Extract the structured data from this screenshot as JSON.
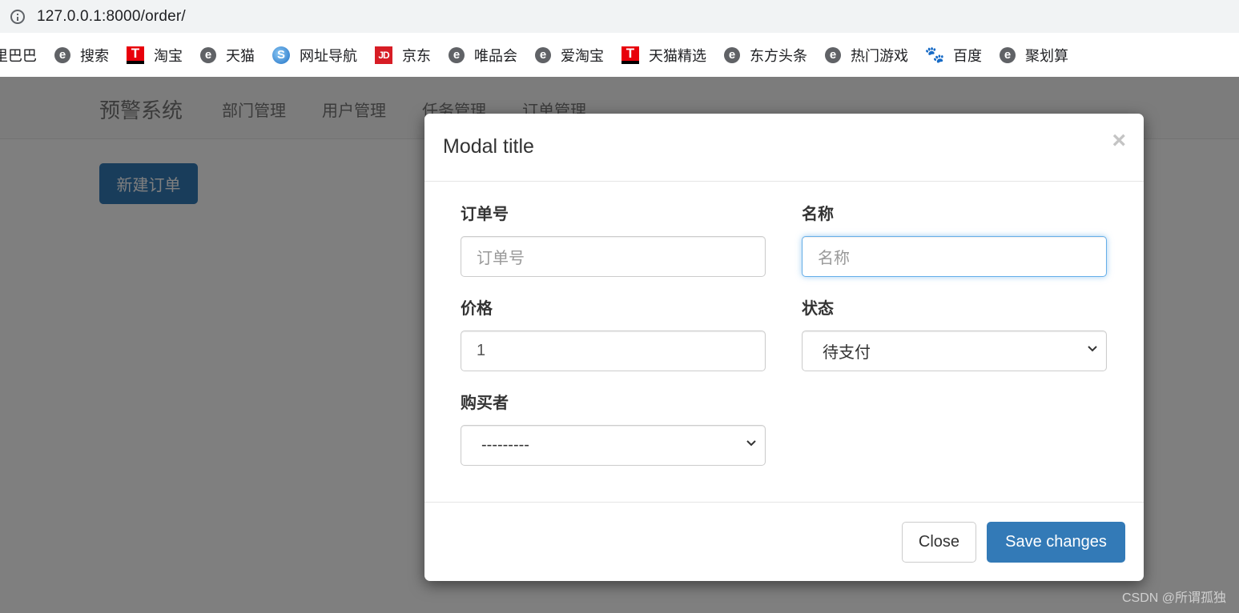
{
  "browser": {
    "url": "127.0.0.1:8000/order/",
    "bookmarks": [
      {
        "label": "里巴巴",
        "icon": "none"
      },
      {
        "label": "搜索",
        "icon": "ie-e-icon"
      },
      {
        "label": "淘宝",
        "icon": "tmall-t-icon"
      },
      {
        "label": "天猫",
        "icon": "ie-e-icon"
      },
      {
        "label": "网址导航",
        "icon": "sogou-s-icon"
      },
      {
        "label": "京东",
        "icon": "jd-icon"
      },
      {
        "label": "唯品会",
        "icon": "ie-e-icon"
      },
      {
        "label": "爱淘宝",
        "icon": "ie-e-icon"
      },
      {
        "label": "天猫精选",
        "icon": "tmall-t-icon"
      },
      {
        "label": "东方头条",
        "icon": "ie-e-icon"
      },
      {
        "label": "热门游戏",
        "icon": "ie-e-icon"
      },
      {
        "label": "百度",
        "icon": "baidu-paw-icon"
      },
      {
        "label": "聚划算",
        "icon": "ie-e-icon"
      }
    ]
  },
  "navbar": {
    "brand": "预警系统",
    "links": [
      "部门管理",
      "用户管理",
      "任务管理",
      "订单管理"
    ]
  },
  "page": {
    "new_order_label": "新建订单"
  },
  "modal": {
    "title": "Modal title",
    "close_glyph": "×",
    "fields": {
      "order_no": {
        "label": "订单号",
        "placeholder": "订单号",
        "value": ""
      },
      "name": {
        "label": "名称",
        "placeholder": "名称",
        "value": ""
      },
      "price": {
        "label": "价格",
        "value": "1"
      },
      "status": {
        "label": "状态",
        "selected": "待支付"
      },
      "buyer": {
        "label": "购买者",
        "selected": "---------"
      }
    },
    "close_label": "Close",
    "save_label": "Save changes"
  },
  "watermark": "CSDN @所谓孤独",
  "colors": {
    "primary": "#337ab7",
    "focus_border": "#66afe9"
  }
}
